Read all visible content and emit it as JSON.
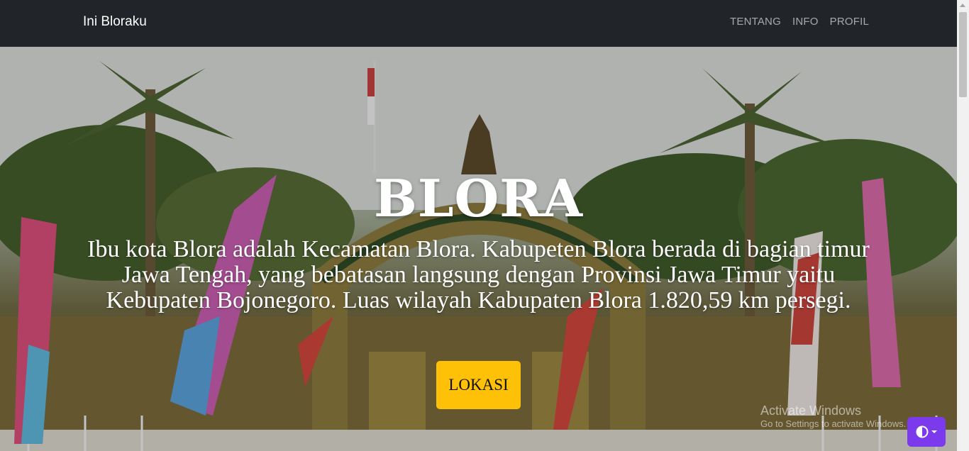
{
  "navbar": {
    "brand": "Ini Bloraku",
    "links": [
      "TENTANG",
      "INFO",
      "PROFIL"
    ]
  },
  "hero": {
    "title": "BLORA",
    "description": "Ibu kota Blora adalah Kecamatan Blora. Kabupeten Blora berada di bagian timur Jawa Tengah, yang bebatasan langsung dengan Provinsi Jawa Timur yaitu Kebupaten Bojonegoro. Luas wilayah Kabupaten Blora 1.820,59 km persegi.",
    "button_label": "LOKASI",
    "button_color": "#ffc107",
    "image": "blora-gate-photo"
  },
  "watermark": {
    "title": "Activate Windows",
    "subtitle": "Go to Settings to activate Windows."
  },
  "theme_toggle": {
    "icon": "contrast-icon",
    "color": "#7c3aed"
  },
  "colors": {
    "navbar_bg": "#212529",
    "nav_link": "rgba(255,255,255,0.6)",
    "text": "#ffffff"
  }
}
